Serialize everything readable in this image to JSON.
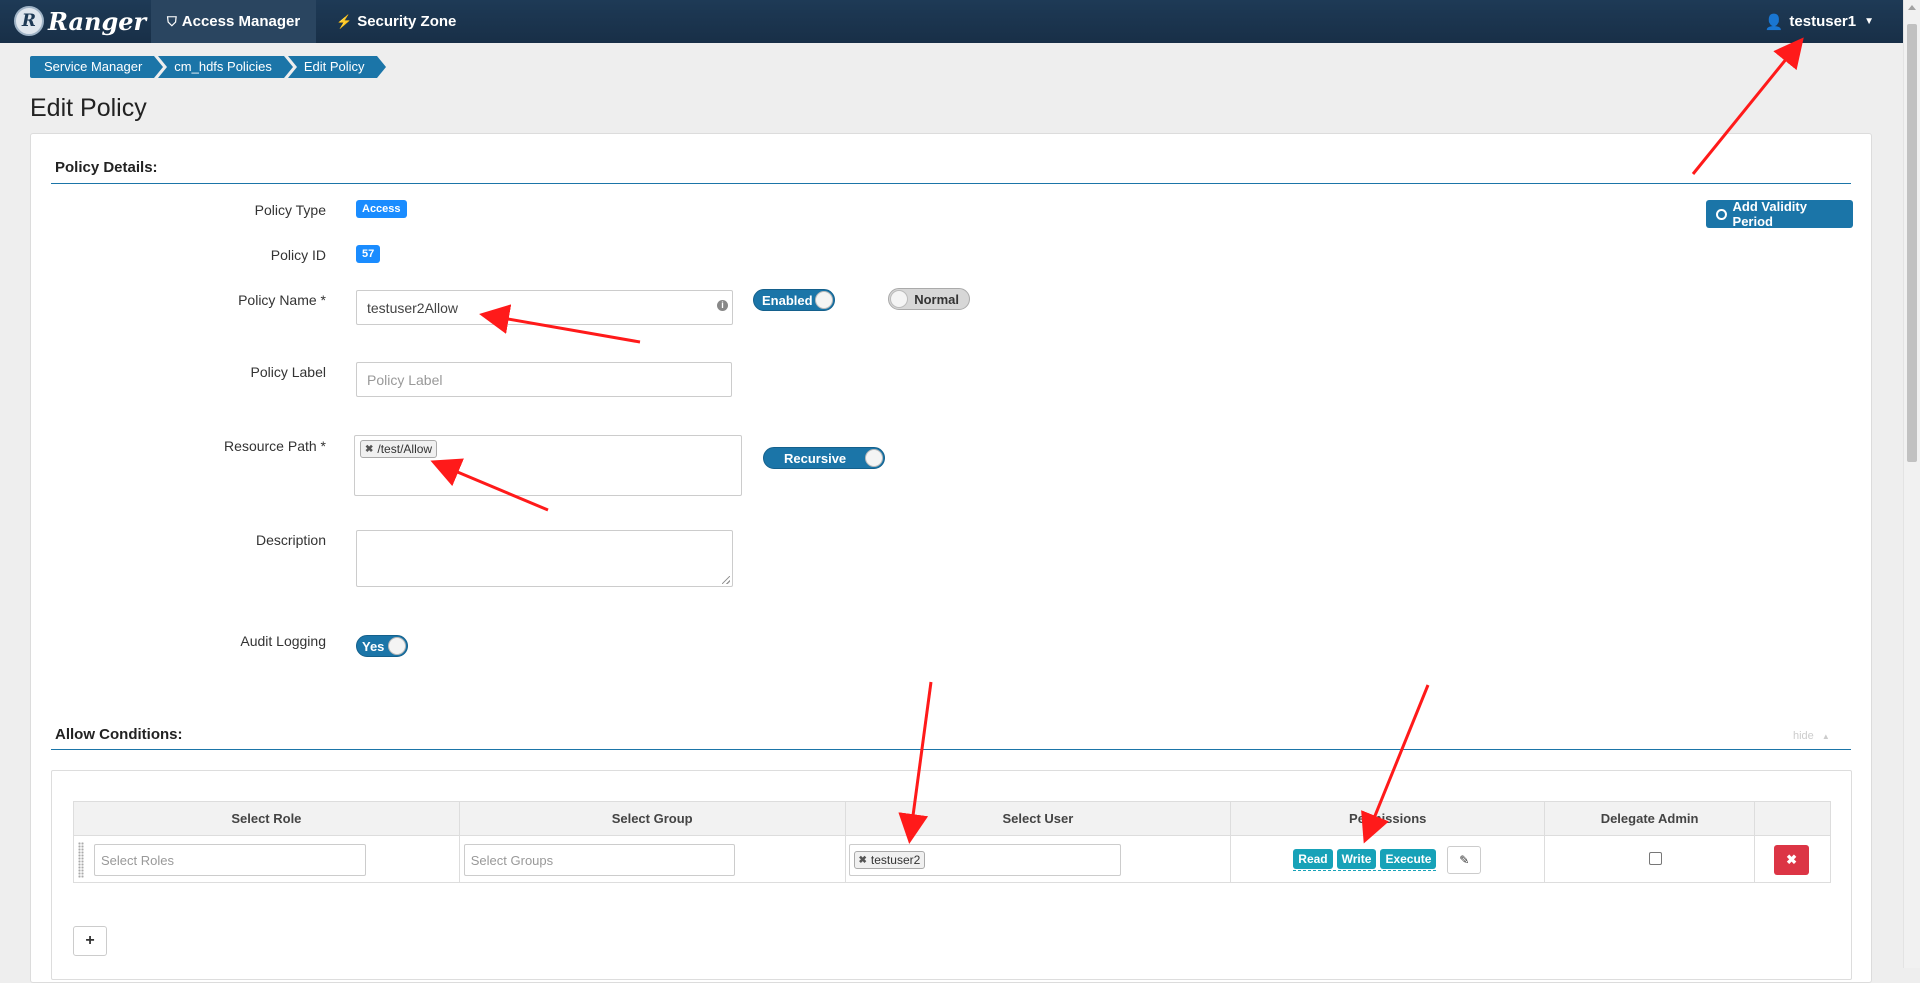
{
  "app": {
    "brand": "Ranger",
    "nav_tabs": [
      {
        "label": "Access Manager",
        "icon": "shield-icon"
      },
      {
        "label": "Security Zone",
        "icon": "bolt-icon"
      }
    ],
    "user": "testuser1"
  },
  "breadcrumb": [
    "Service Manager",
    "cm_hdfs Policies",
    "Edit Policy"
  ],
  "page_title": "Edit Policy",
  "policy_details": {
    "section_title": "Policy Details:",
    "add_validity_label": "Add Validity Period",
    "policy_type": {
      "label": "Policy Type",
      "value": "Access"
    },
    "policy_id": {
      "label": "Policy ID",
      "value": "57"
    },
    "policy_name": {
      "label": "Policy Name *",
      "value": "testuser2Allow",
      "enabled_toggle": "Enabled",
      "normal_toggle": "Normal"
    },
    "policy_label": {
      "label": "Policy Label",
      "placeholder": "Policy Label"
    },
    "resource_path": {
      "label": "Resource Path *",
      "chip": "/test/Allow",
      "recursive_toggle": "Recursive"
    },
    "description": {
      "label": "Description",
      "value": ""
    },
    "audit_logging": {
      "label": "Audit Logging",
      "toggle": "Yes"
    }
  },
  "allow_conditions": {
    "section_title": "Allow Conditions:",
    "hide_link": "hide",
    "columns": [
      "Select Role",
      "Select Group",
      "Select User",
      "Permissions",
      "Delegate Admin",
      ""
    ],
    "row": {
      "roles_placeholder": "Select Roles",
      "groups_placeholder": "Select Groups",
      "user_chip": "testuser2",
      "permissions": [
        "Read",
        "Write",
        "Execute"
      ],
      "delegate_admin": false
    },
    "add_label": "+"
  },
  "colors": {
    "navbar": "#1e3a56",
    "accent": "#1b75a8",
    "badge": "#1a8cff",
    "permission": "#17a2b8",
    "danger": "#dc3545",
    "annotation_arrow": "#ff1a1a"
  }
}
